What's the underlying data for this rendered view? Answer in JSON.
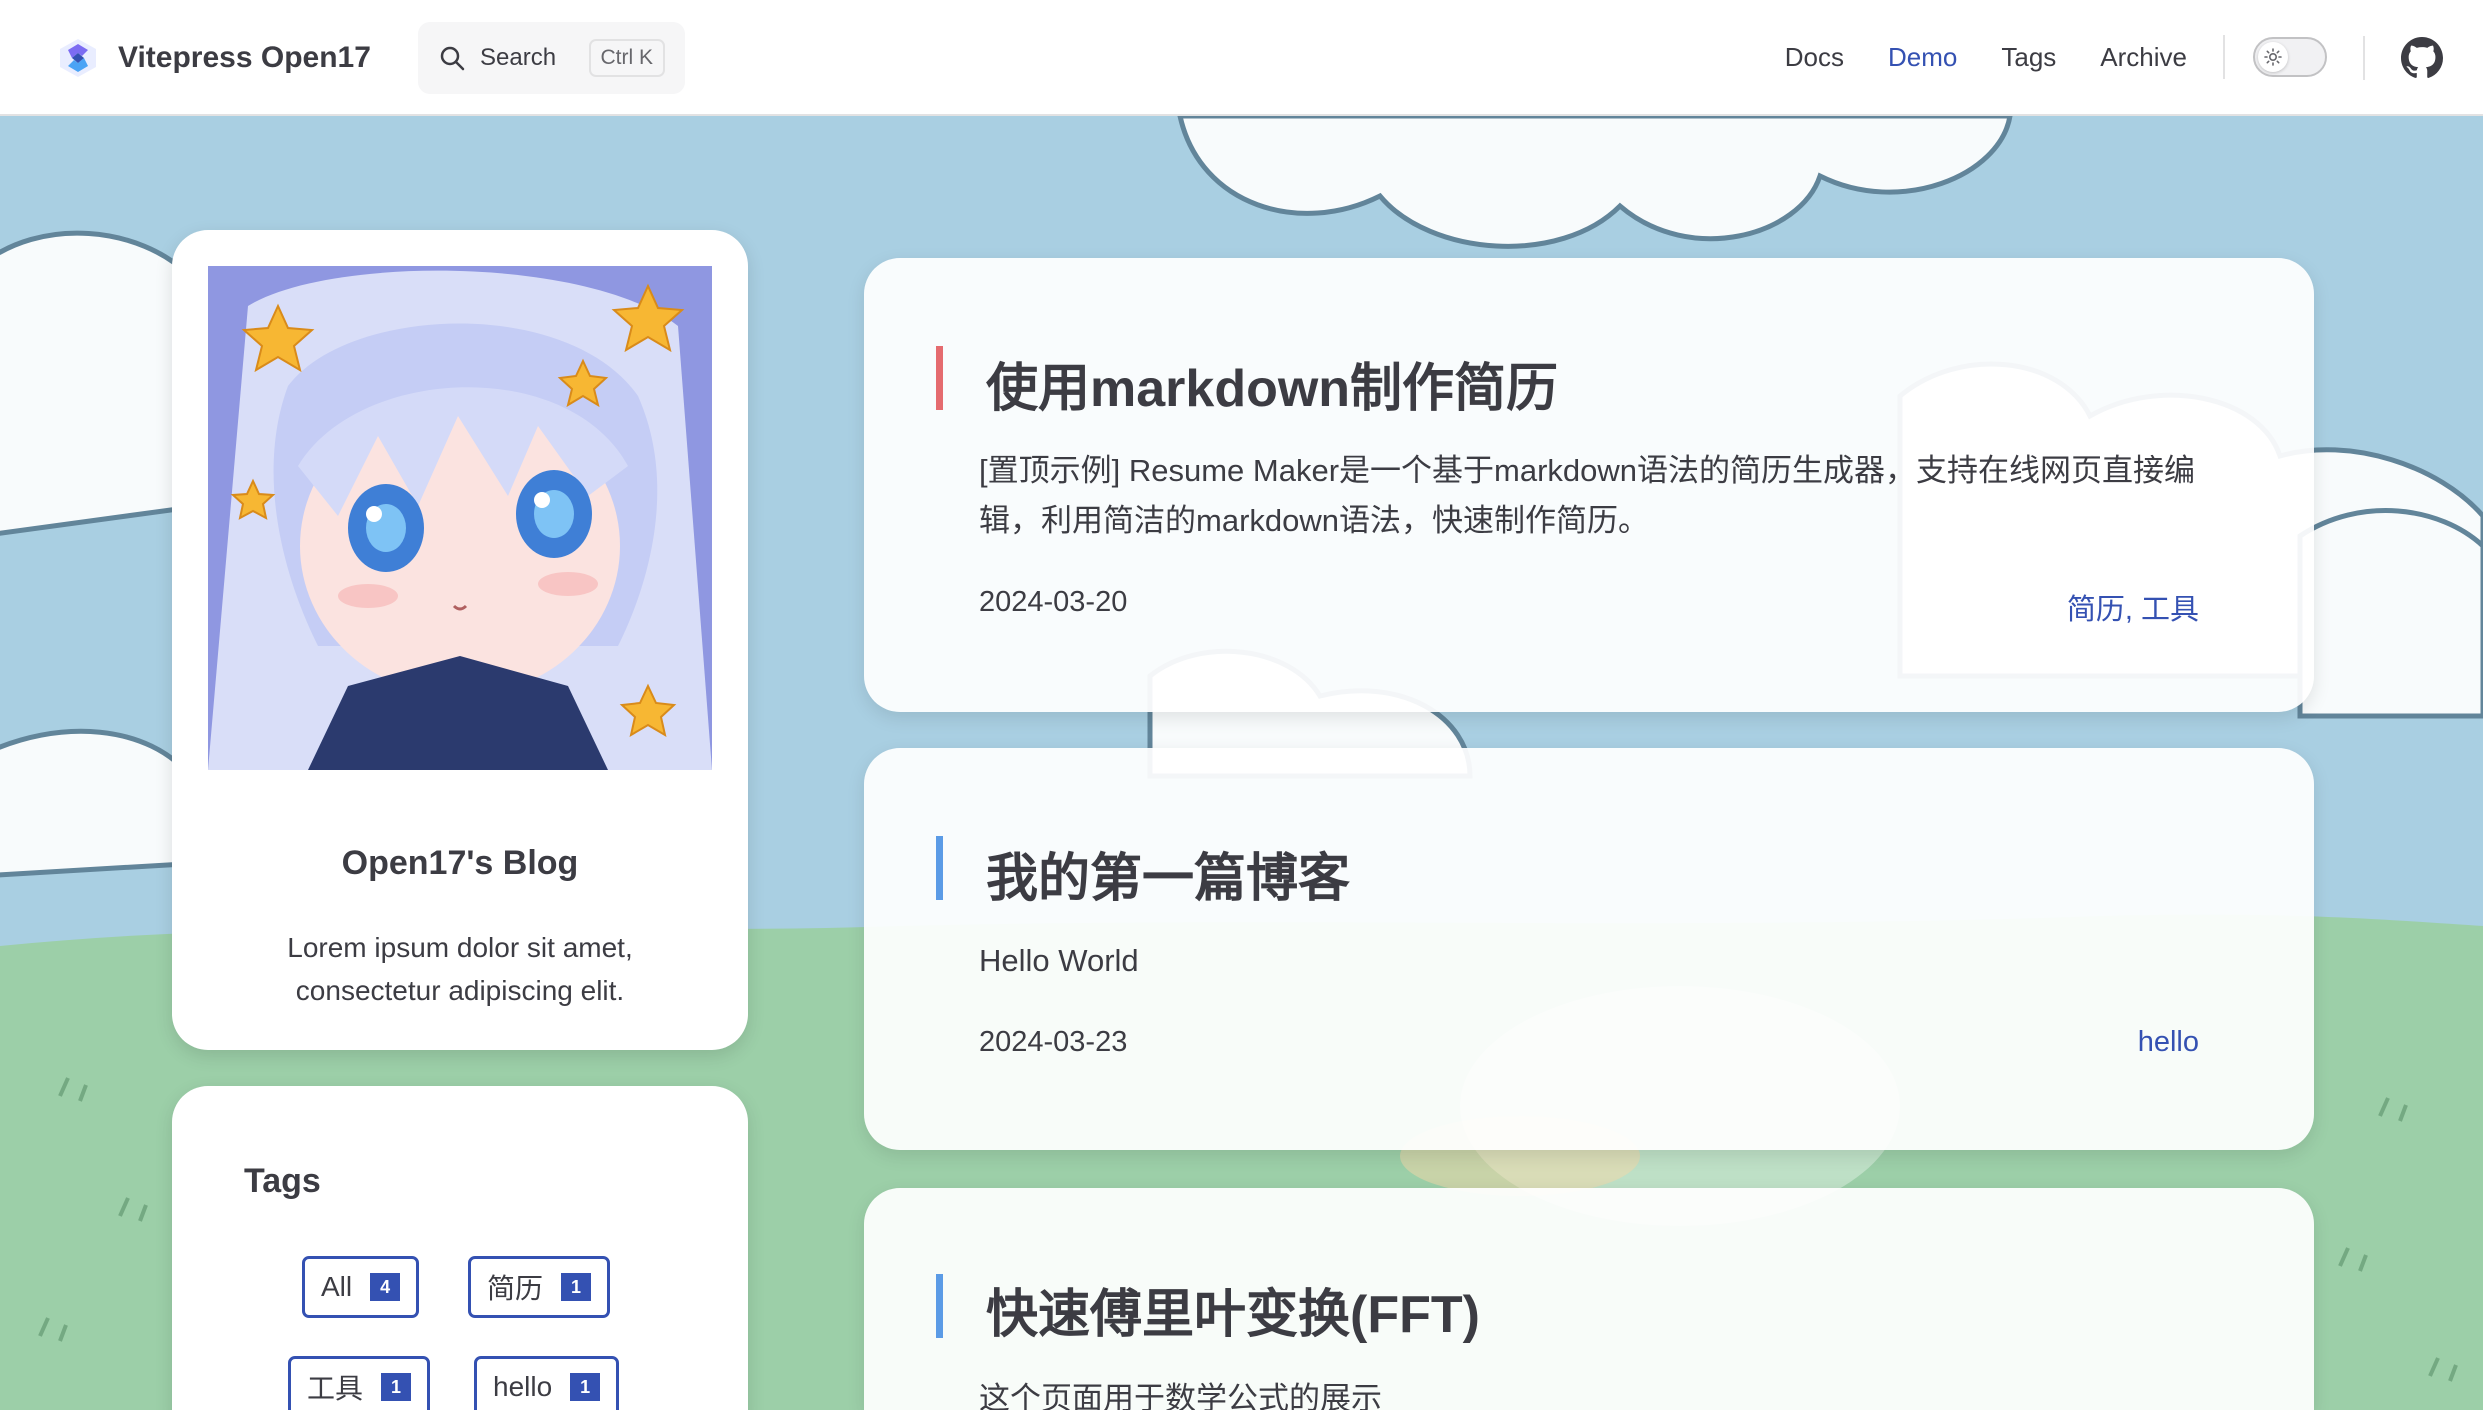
{
  "navbar": {
    "brand_title": "Vitepress Open17",
    "search_label": "Search",
    "search_shortcut": "Ctrl K",
    "links": [
      {
        "label": "Docs",
        "active": false
      },
      {
        "label": "Demo",
        "active": true
      },
      {
        "label": "Tags",
        "active": false
      },
      {
        "label": "Archive",
        "active": false
      }
    ],
    "theme_toggle": "sun-icon",
    "github_icon": "github-icon"
  },
  "profile": {
    "name": "Open17's Blog",
    "description": "Lorem ipsum dolor sit amet, consectetur adipiscing elit."
  },
  "tags": {
    "title": "Tags",
    "items": [
      {
        "label": "All",
        "count": "4"
      },
      {
        "label": "简历",
        "count": "1"
      },
      {
        "label": "工具",
        "count": "1"
      },
      {
        "label": "hello",
        "count": "1"
      }
    ]
  },
  "posts": [
    {
      "title": "使用markdown制作简历",
      "excerpt": "[置顶示例] Resume Maker是一个基于markdown语法的简历生成器，支持在线网页直接编辑，利用简洁的markdown语法，快速制作简历。",
      "date": "2024-03-20",
      "tags": "简历, 工具",
      "accent": "#e56b6f"
    },
    {
      "title": "我的第一篇博客",
      "excerpt": "Hello World",
      "date": "2024-03-23",
      "tags": "hello",
      "accent": "#5b9be6"
    },
    {
      "title": "快速傅里叶变换(FFT)",
      "excerpt": "这个页面用于数学公式的展示",
      "accent": "#5b9be6"
    }
  ],
  "colors": {
    "brand": "#3451b2",
    "text": "#3c3c43",
    "sky": "#a9cfe2",
    "grass": "#9ccfa8"
  }
}
